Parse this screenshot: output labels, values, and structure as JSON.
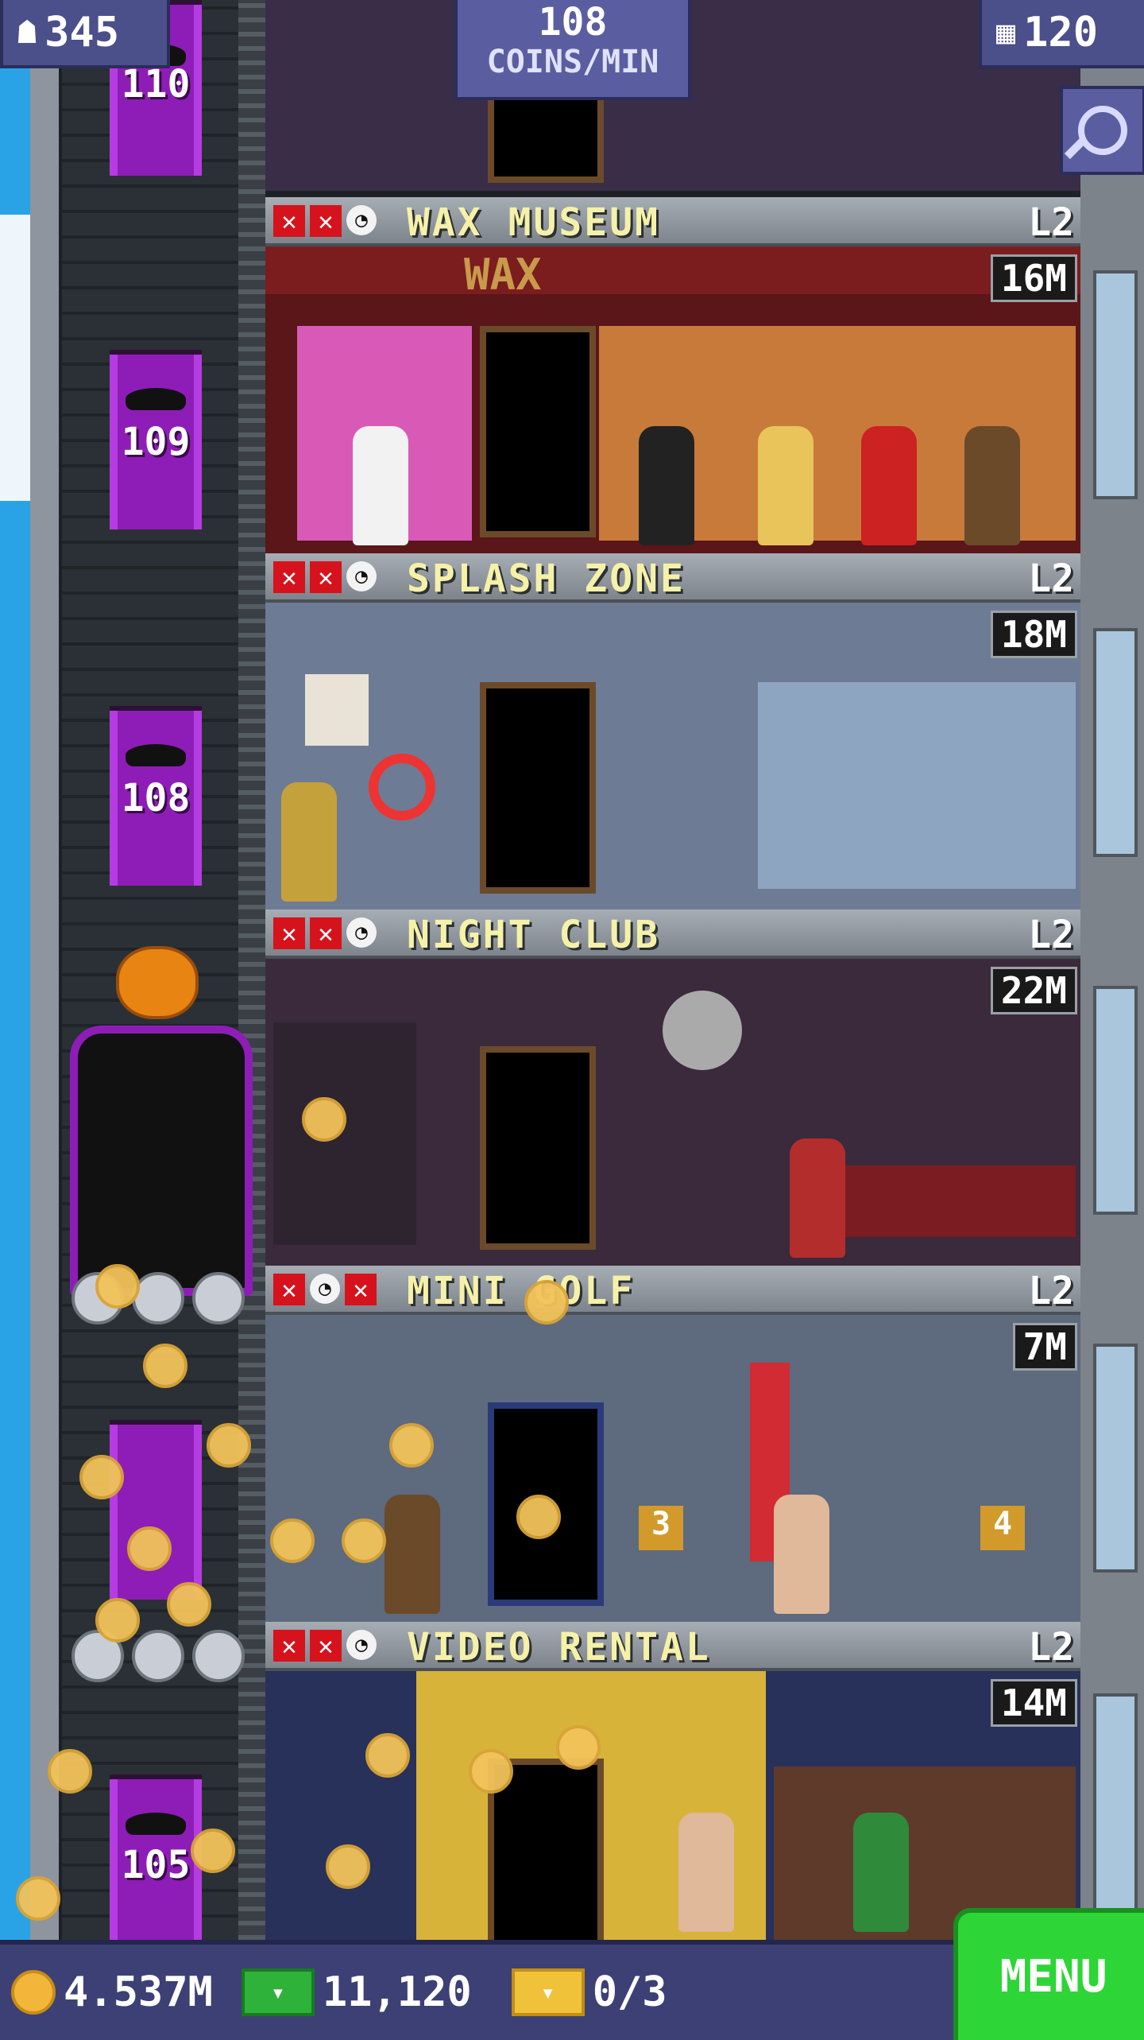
{
  "hud": {
    "population": "345",
    "coins_per_min_value": "108",
    "coins_per_min_unit": "COINS/MIN",
    "floors": "120"
  },
  "elevator": {
    "floor_labels": [
      "110",
      "109",
      "108",
      "105"
    ]
  },
  "floors": [
    {
      "name": "WAX MUSEUM",
      "level": "L2",
      "value": "16M",
      "theme": "wax"
    },
    {
      "name": "SPLASH ZONE",
      "level": "L2",
      "value": "18M",
      "theme": "splash"
    },
    {
      "name": "NIGHT CLUB",
      "level": "L2",
      "value": "22M",
      "theme": "night"
    },
    {
      "name": "MINI GOLF",
      "level": "L2",
      "value": "7M",
      "theme": "golf"
    },
    {
      "name": "VIDEO RENTAL",
      "level": "L2",
      "value": "14M",
      "theme": "video"
    }
  ],
  "room_details": {
    "wax_sign": "WAX",
    "golf_flag_left": "3",
    "golf_flag_right": "4"
  },
  "bottom_bar": {
    "coins": "4.537M",
    "bux": "11,120",
    "tickets": "0/3",
    "menu_label": "MENU"
  },
  "colors": {
    "accent_purple": "#8e1db7",
    "menu_green": "#2ed536",
    "floor_title": "#f5f1a8",
    "x_red": "#d6121d"
  }
}
